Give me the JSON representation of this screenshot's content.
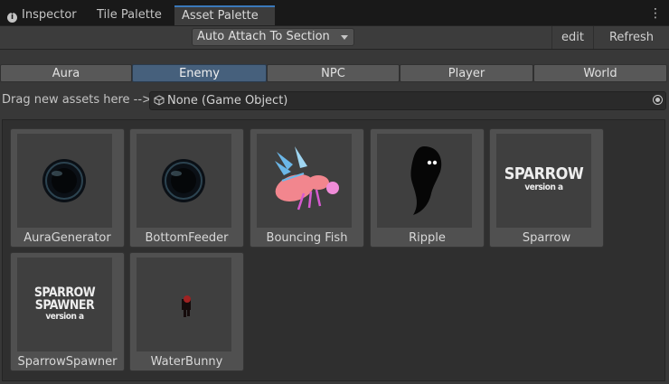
{
  "tabs": [
    {
      "label": "Inspector",
      "icon": "info-icon"
    },
    {
      "label": "Tile Palette"
    },
    {
      "label": "Asset Palette",
      "active": true
    }
  ],
  "toolbar": {
    "dropdown_value": "Auto Attach To Section",
    "edit_label": "edit",
    "refresh_label": "Refresh"
  },
  "sections": [
    {
      "label": "Aura"
    },
    {
      "label": "Enemy",
      "active": true
    },
    {
      "label": "NPC"
    },
    {
      "label": "Player"
    },
    {
      "label": "World"
    }
  ],
  "drag": {
    "label": "Drag new assets here -->",
    "field_value": "None (Game Object)"
  },
  "assets": [
    {
      "label": "AuraGenerator",
      "icon": "dark-orb-icon"
    },
    {
      "label": "BottomFeeder",
      "icon": "dark-orb-icon"
    },
    {
      "label": "Bouncing Fish",
      "icon": "wasp-fish-icon"
    },
    {
      "label": "Ripple",
      "icon": "shadow-blob-icon"
    },
    {
      "label": "Sparrow",
      "icon": "sparrow-text-icon",
      "thumb_lines": [
        "SPARROW",
        "version a"
      ]
    },
    {
      "label": "SparrowSpawner",
      "icon": "sparrow-spawner-text-icon",
      "thumb_lines": [
        "SPARROW",
        "SPAWNER",
        "version a"
      ]
    },
    {
      "label": "WaterBunny",
      "icon": "bunny-icon"
    }
  ],
  "colors": {
    "active_section": "#46607c",
    "active_tab_accent": "#3a79bb"
  }
}
